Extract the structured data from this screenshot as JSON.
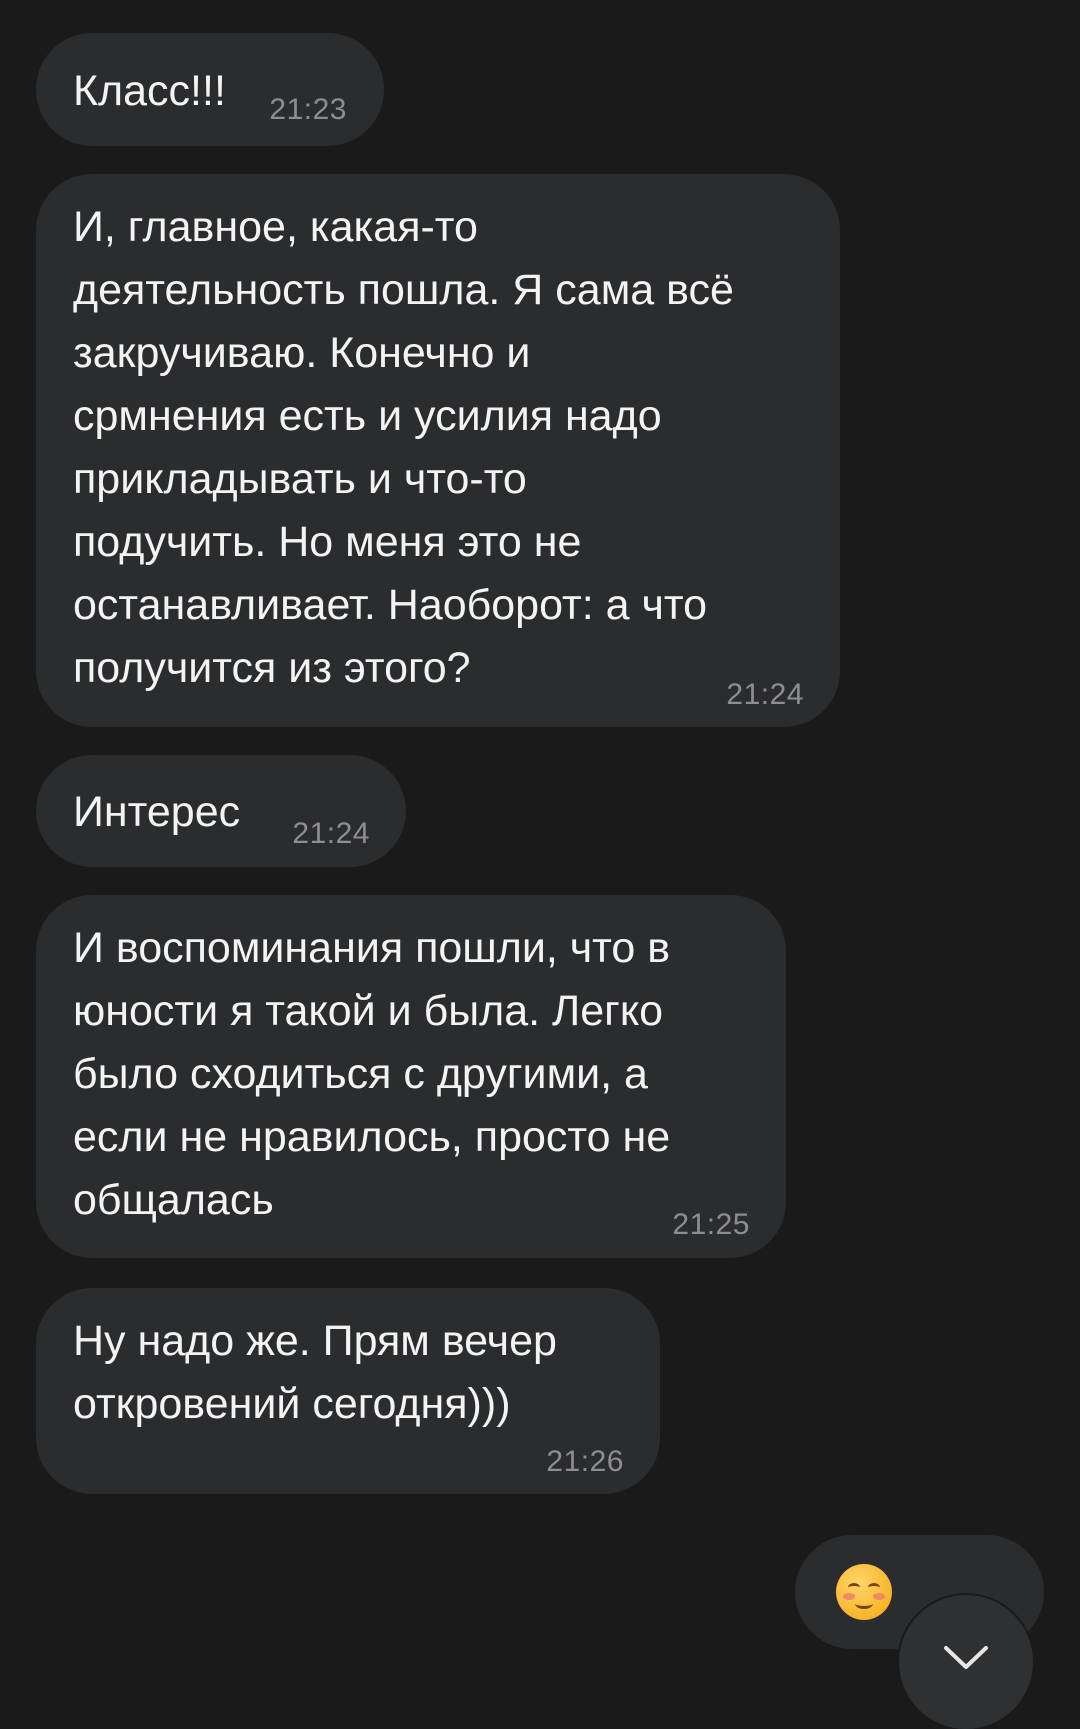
{
  "messages": [
    {
      "text": "Класс!!!",
      "time": "21:23"
    },
    {
      "text": "И, главное, какая-то\nдеятельность пошла. Я сама всё\nзакручиваю. Конечно и\nсрмнения есть и усилия надо\nприкладывать и что-то\nподучить. Но меня это не\nостанавливает. Наоборот: а что\nполучится из этого?",
      "time": "21:24"
    },
    {
      "text": "Интерес",
      "time": "21:24"
    },
    {
      "text": "И воспоминания пошли, что в\nюности я такой и была. Легко\nбыло сходиться с другими, а\nесли не нравилось, просто не\nобщалась",
      "time": "21:25"
    },
    {
      "text": "Ну надо же. Прям вечер\nоткровений сегодня)))",
      "time": "21:26"
    }
  ],
  "outgoing": {
    "emoji": "smiling-face-with-blush"
  },
  "icons": {
    "scroll_down": "chevron-down-icon"
  },
  "colors": {
    "background": "#1a1a1a",
    "bubble": "#2b2c2e",
    "text": "#f3f3f3",
    "time": "#8e8e90"
  }
}
